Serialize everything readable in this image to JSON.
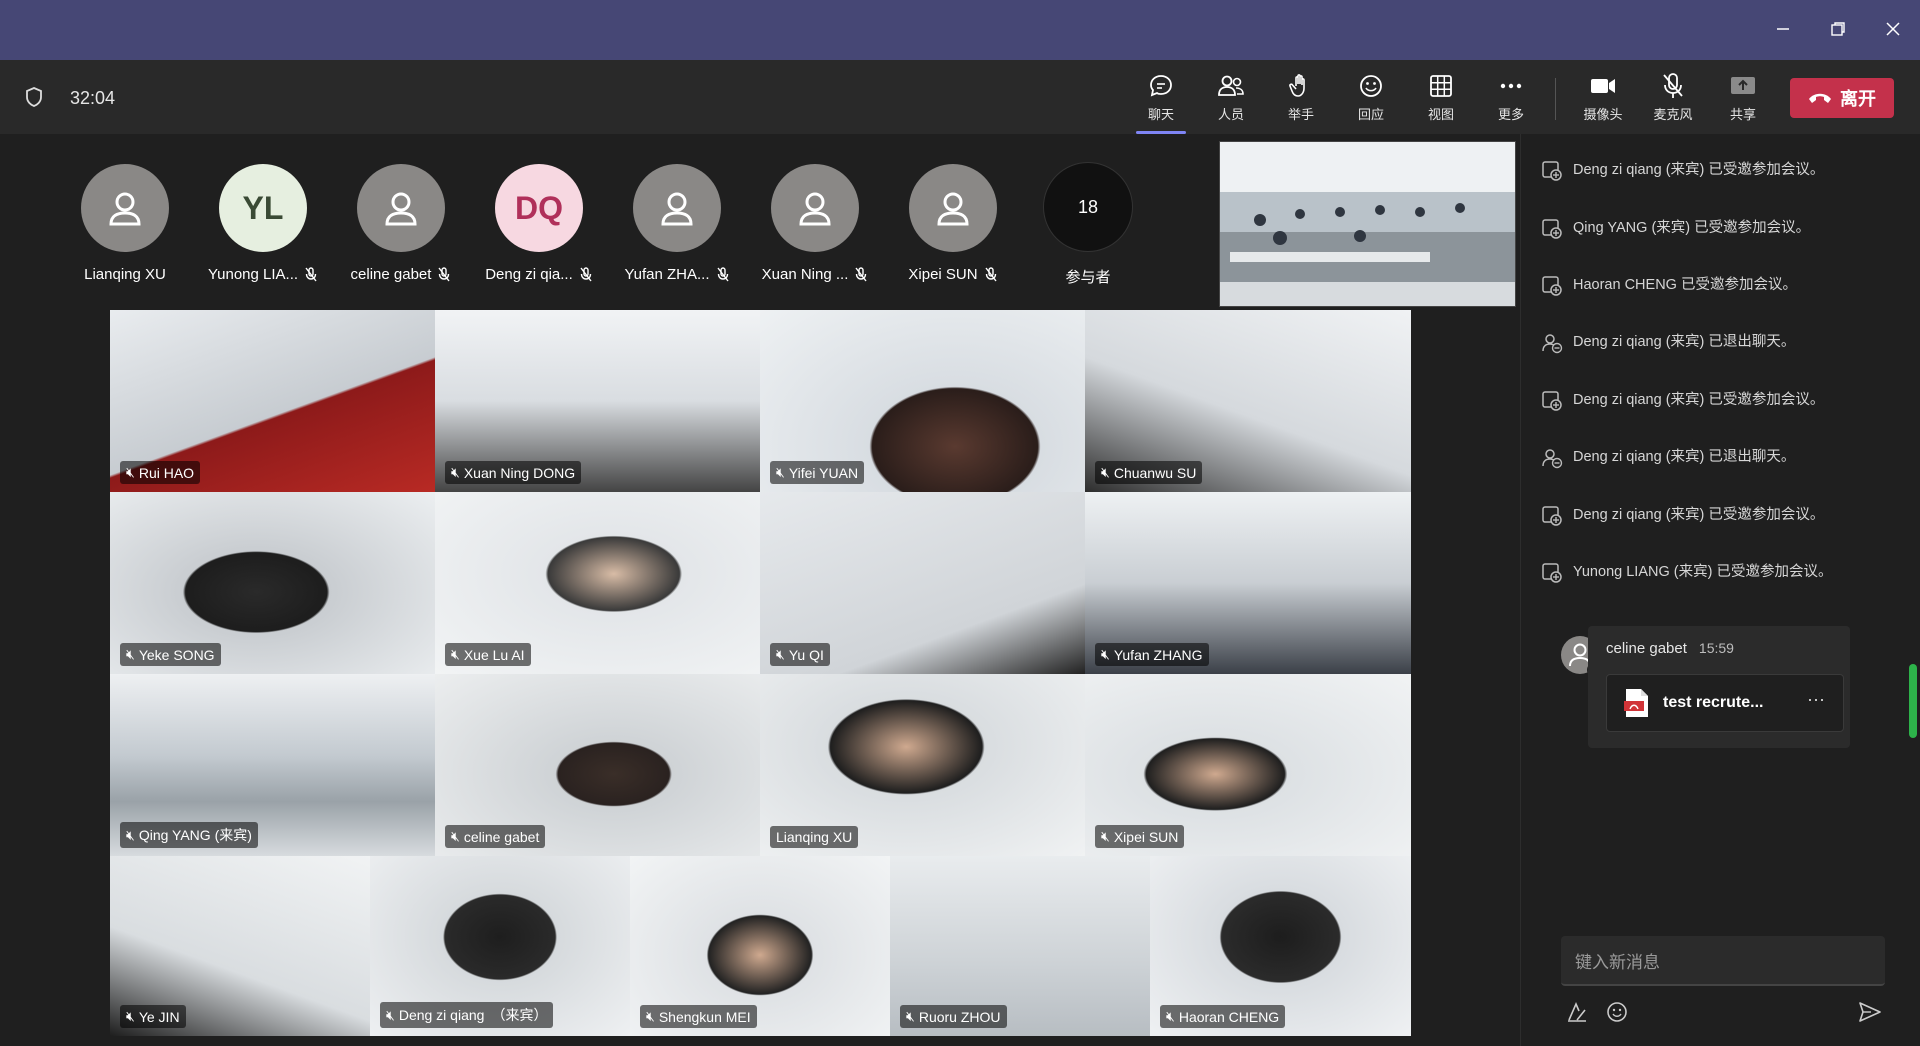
{
  "toolbar": {
    "timer": "32:04",
    "buttons": [
      {
        "label": "聊天",
        "icon": "chat-icon"
      },
      {
        "label": "人员",
        "icon": "people-icon"
      },
      {
        "label": "举手",
        "icon": "raise-hand-icon"
      },
      {
        "label": "回应",
        "icon": "reaction-icon"
      },
      {
        "label": "视图",
        "icon": "view-icon"
      },
      {
        "label": "更多",
        "icon": "more-icon"
      },
      {
        "label": "摄像头",
        "icon": "camera-icon"
      },
      {
        "label": "麦克风",
        "icon": "mic-off-icon"
      },
      {
        "label": "共享",
        "icon": "share-icon"
      }
    ],
    "leave_label": "离开"
  },
  "participants_strip": [
    {
      "name": "Lianqing XU",
      "initials": ""
    },
    {
      "name": "Yunong LIA...",
      "initials": "YL"
    },
    {
      "name": "celine gabet",
      "initials": ""
    },
    {
      "name": "Deng zi qia...",
      "initials": "DQ"
    },
    {
      "name": "Yufan ZHA...",
      "initials": ""
    },
    {
      "name": "Xuan Ning ...",
      "initials": ""
    },
    {
      "name": "Xipei SUN",
      "initials": ""
    }
  ],
  "participants_count": "18",
  "participants_count_label": "参与者",
  "video_tiles": [
    "Rui HAO",
    "Xuan Ning DONG",
    "Yifei YUAN",
    "Chuanwu SU",
    "Yeke SONG",
    "Xue Lu AI",
    "Yu QI",
    "Yufan ZHANG",
    "Qing YANG (来宾)",
    "celine gabet",
    "Lianqing XU",
    "Xipei SUN",
    "Ye JIN",
    "Deng zi qiang　（来宾）",
    "Shengkun MEI",
    "Ruoru ZHOU",
    "Haoran CHENG"
  ],
  "chat": {
    "events": [
      "Deng zi qiang (来宾) 已受邀参加会议。",
      "Qing YANG (来宾) 已受邀参加会议。",
      "Haoran CHENG 已受邀参加会议。",
      "Deng zi qiang (来宾) 已退出聊天。",
      "Deng zi qiang (来宾) 已受邀参加会议。",
      "Deng zi qiang (来宾) 已退出聊天。",
      "Deng zi qiang (来宾) 已受邀参加会议。",
      "Yunong LIANG (来宾) 已受邀参加会议。"
    ],
    "message": {
      "sender": "celine gabet",
      "time": "15:59",
      "file_name": "test recrute..."
    },
    "input_placeholder": "键入新消息"
  }
}
